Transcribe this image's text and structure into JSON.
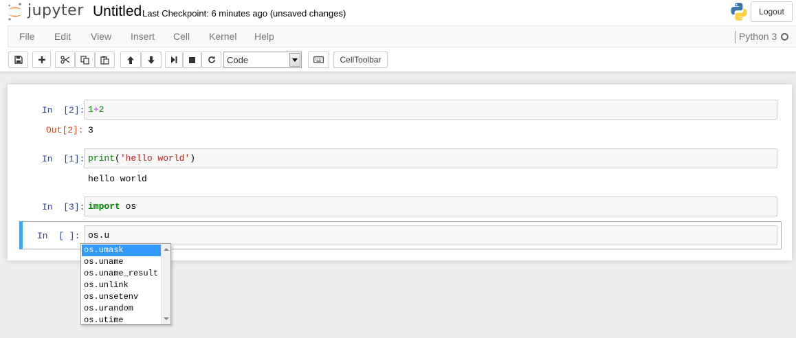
{
  "header": {
    "logo_text": "jupyter",
    "notebook_name": "Untitled",
    "checkpoint": "Last Checkpoint: 6 minutes ago (unsaved changes)",
    "logout_label": "Logout"
  },
  "menu": {
    "items": [
      "File",
      "Edit",
      "View",
      "Insert",
      "Cell",
      "Kernel",
      "Help"
    ],
    "kernel_name": "Python 3"
  },
  "toolbar": {
    "cell_type": "Code",
    "celltoolbar_label": "CellToolbar",
    "icons": [
      "save-icon",
      "plus-icon",
      "cut-icon",
      "copy-icon",
      "paste-icon",
      "arrow-up-icon",
      "arrow-down-icon",
      "run-icon",
      "stop-icon",
      "restart-icon",
      "keyboard-icon"
    ]
  },
  "cells": [
    {
      "prompt": "In  [2]:",
      "code": {
        "a": "1",
        "op": "+",
        "b": "2"
      },
      "out_prompt": "Out[2]:",
      "output": "3"
    },
    {
      "prompt": "In  [1]:",
      "code": {
        "fn": "print",
        "open": "(",
        "str": "'hello world'",
        "close": ")"
      },
      "output": "hello world"
    },
    {
      "prompt": "In  [3]:",
      "code": {
        "kw": "import",
        "rest": " os"
      }
    },
    {
      "prompt": "In  [ ]:",
      "code": {
        "text": "os.u"
      }
    }
  ],
  "completer": {
    "selected_index": 0,
    "items": [
      "os.umask",
      "os.uname",
      "os.uname_result",
      "os.unlink",
      "os.unsetenv",
      "os.urandom",
      "os.utime"
    ]
  },
  "colors": {
    "in_prompt": "#303f9f",
    "out_prompt": "#d84315",
    "selected_cell_bar": "#42a5f5",
    "completer_highlight": "#3399ff",
    "jupyter_orange": "#f37726"
  }
}
